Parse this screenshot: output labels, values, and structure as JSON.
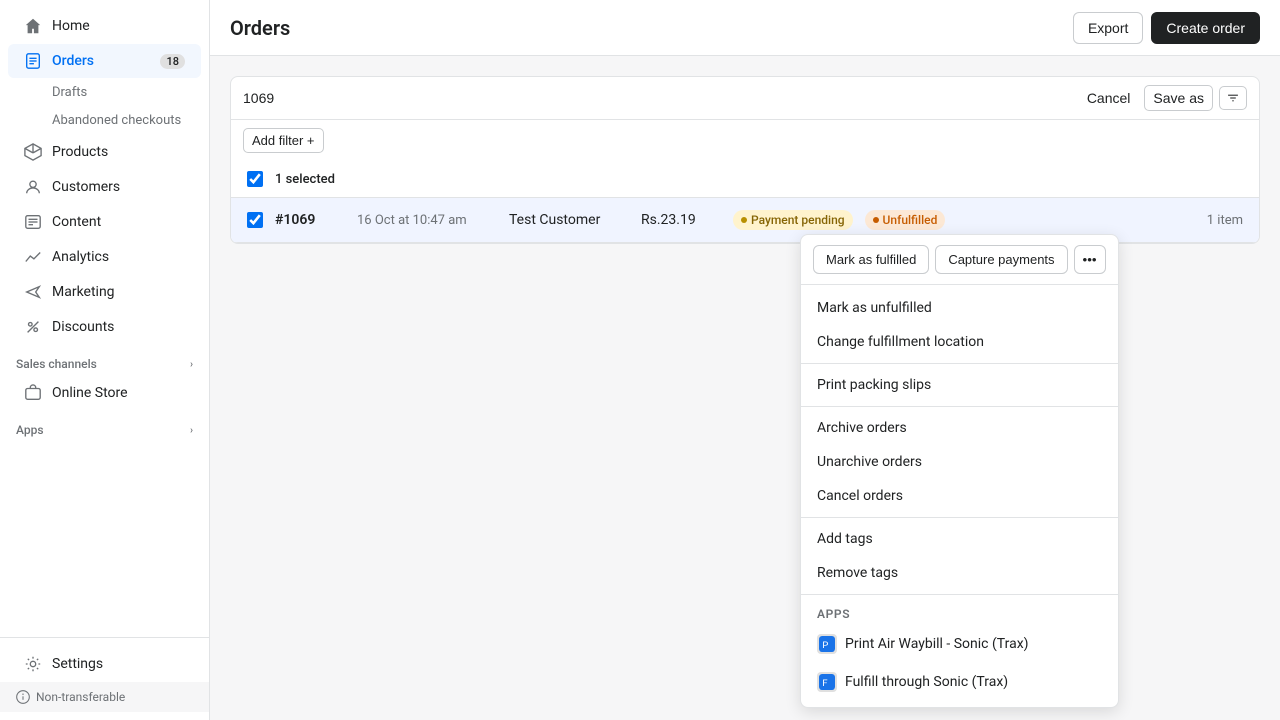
{
  "sidebar": {
    "home": "Home",
    "orders": "Orders",
    "orders_badge": "18",
    "drafts": "Drafts",
    "abandoned_checkouts": "Abandoned checkouts",
    "products": "Products",
    "customers": "Customers",
    "content": "Content",
    "analytics": "Analytics",
    "marketing": "Marketing",
    "discounts": "Discounts",
    "sales_channels": "Sales channels",
    "online_store": "Online Store",
    "apps": "Apps",
    "settings": "Settings",
    "non_transferable": "Non-transferable"
  },
  "header": {
    "title": "Orders",
    "export_label": "Export",
    "create_order_label": "Create order"
  },
  "filter_bar": {
    "search_value": "1069",
    "cancel_label": "Cancel",
    "save_as_label": "Save as"
  },
  "add_filter": {
    "label": "Add filter +"
  },
  "table": {
    "selected_label": "1 selected",
    "row": {
      "order_number": "#1069",
      "date": "16 Oct at 10:47 am",
      "customer": "Test Customer",
      "amount": "Rs.23.19",
      "payment_status": "Payment pending",
      "fulfillment_status": "Unfulfilled",
      "items": "1 item"
    }
  },
  "action_toolbar": {
    "mark_fulfilled": "Mark as fulfilled",
    "capture_payments": "Capture payments",
    "more_icon": "···"
  },
  "dropdown": {
    "items": [
      {
        "label": "Mark as unfulfilled",
        "group": "fulfillment"
      },
      {
        "label": "Change fulfillment location",
        "group": "fulfillment"
      },
      {
        "label": "Print packing slips",
        "group": "print"
      },
      {
        "label": "Archive orders",
        "group": "archive"
      },
      {
        "label": "Unarchive orders",
        "group": "archive"
      },
      {
        "label": "Cancel orders",
        "group": "archive"
      },
      {
        "label": "Add tags",
        "group": "tags"
      },
      {
        "label": "Remove tags",
        "group": "tags"
      }
    ],
    "apps_section_label": "Apps",
    "app_items": [
      {
        "label": "Print Air Waybill - Sonic (Trax)"
      },
      {
        "label": "Fulfill through Sonic (Trax)"
      }
    ]
  }
}
